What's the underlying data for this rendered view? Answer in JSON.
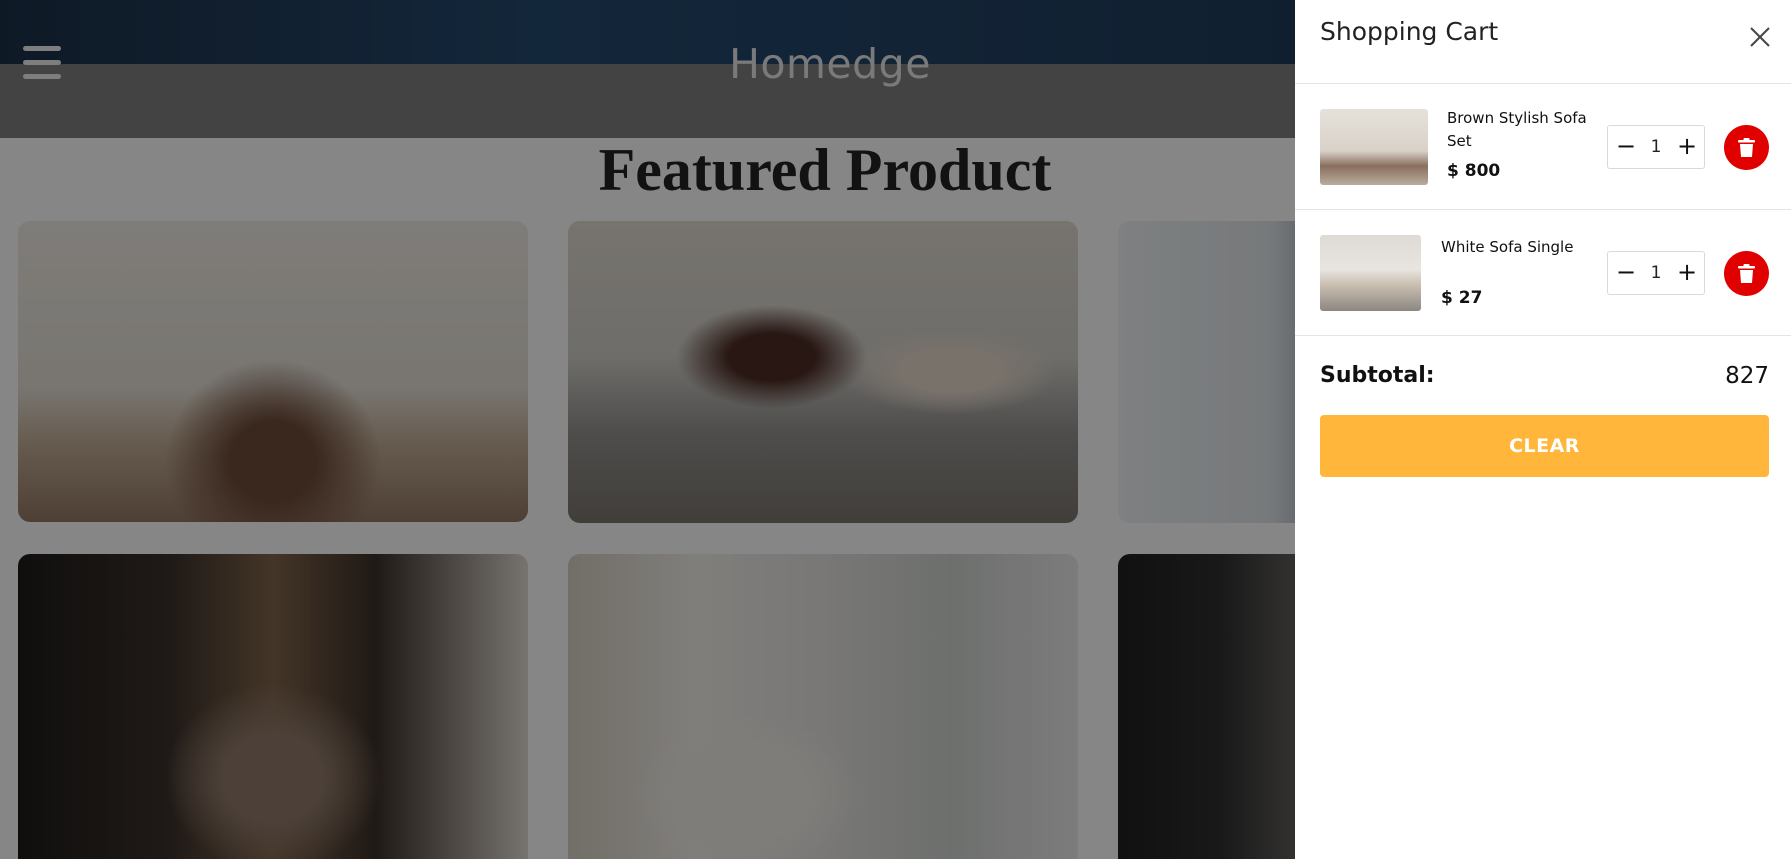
{
  "header": {
    "brand": "Homedge",
    "menu_icon": "hamburger-menu-icon"
  },
  "main": {
    "section_title": "Featured Product",
    "products_visible": 6
  },
  "cart": {
    "title": "Shopping Cart",
    "close_icon": "close-icon",
    "items": [
      {
        "name": "Brown Stylish Sofa Set",
        "price": "$ 800",
        "quantity": "1",
        "minus": "−",
        "plus": "+"
      },
      {
        "name": "White Sofa Single",
        "price": "$ 27",
        "quantity": "1",
        "minus": "−",
        "plus": "+"
      }
    ],
    "delete_icon": "trash-icon",
    "subtotal_label": "Subtotal:",
    "subtotal_value": "827",
    "clear_label": "CLEAR"
  },
  "colors": {
    "accent": "#ffb63a",
    "delete": "#e00000",
    "navbar": "#7b7b7b",
    "overlay": "rgba(0,0,0,0.45)"
  }
}
